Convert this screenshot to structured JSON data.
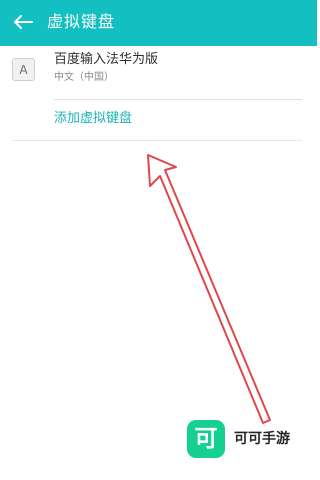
{
  "header": {
    "title": "虚拟键盘",
    "back_icon": "arrow-left-icon"
  },
  "keyboards": [
    {
      "icon_letter": "A",
      "name": "百度输入法华为版",
      "language": "中文（中国）"
    }
  ],
  "actions": {
    "add_keyboard": "添加虚拟键盘"
  },
  "watermark": {
    "logo_char": "可",
    "text": "可可手游"
  },
  "colors": {
    "header_bg": "#13bfc0",
    "accent": "#1bb3b5",
    "annotation": "#e0474c",
    "watermark_logo": "#16cf93"
  }
}
